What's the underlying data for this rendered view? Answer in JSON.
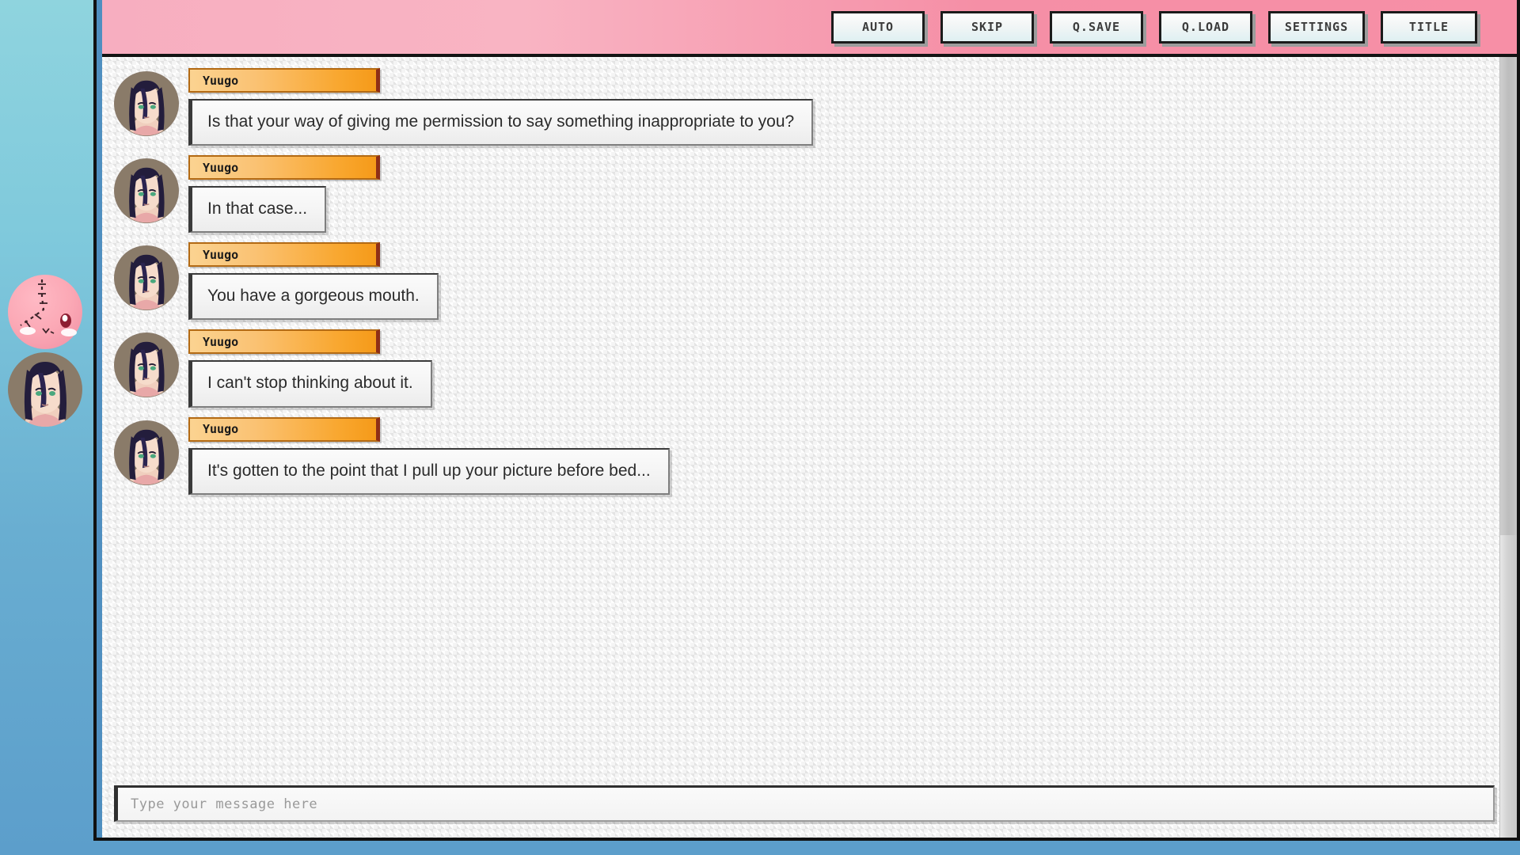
{
  "window": {
    "background_color": "#7fc9dc",
    "frame_border_color": "#111111"
  },
  "topbar": {
    "background_color": "#f7aec0",
    "buttons": [
      {
        "label": "AUTO",
        "name": "auto-button"
      },
      {
        "label": "SKIP",
        "name": "skip-button"
      },
      {
        "label": "Q.SAVE",
        "name": "quick-save-button"
      },
      {
        "label": "Q.LOAD",
        "name": "quick-load-button"
      },
      {
        "label": "SETTINGS",
        "name": "settings-button"
      },
      {
        "label": "TITLE",
        "name": "title-button"
      }
    ]
  },
  "chat": {
    "nameplate_color": "#f9a72f",
    "bubble_color": "#f4f4f4",
    "messages": [
      {
        "speaker": "Yuugo",
        "text": "Is that your way of giving me permission to say something inappropriate to you?"
      },
      {
        "speaker": "Yuugo",
        "text": "In that case..."
      },
      {
        "speaker": "Yuugo",
        "text": "You have a gorgeous mouth."
      },
      {
        "speaker": "Yuugo",
        "text": "I can't stop thinking about it."
      },
      {
        "speaker": "Yuugo",
        "text": "It's gotten to the point that I pull up your picture before bed..."
      }
    ]
  },
  "input": {
    "value": "",
    "placeholder": "Type your message here"
  },
  "scrollbar": {
    "orientation": "vertical",
    "thumb_position": "top"
  },
  "sidebar": {
    "characters": [
      {
        "name": "pink-blob-mascot",
        "label": ""
      },
      {
        "name": "yuugo-portrait",
        "label": ""
      }
    ]
  }
}
